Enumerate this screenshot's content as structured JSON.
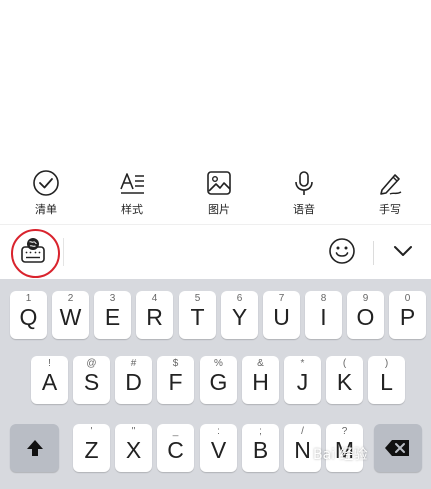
{
  "toolbar": {
    "items": [
      {
        "label": "清单",
        "icon": "checklist-icon"
      },
      {
        "label": "样式",
        "icon": "text-style-icon"
      },
      {
        "label": "图片",
        "icon": "image-icon"
      },
      {
        "label": "语音",
        "icon": "microphone-icon"
      },
      {
        "label": "手写",
        "icon": "handwriting-pen-icon"
      }
    ]
  },
  "keyboard_bar": {
    "left_icon": "keyboard-globe-icon",
    "emoji_icon": "emoji-smile-icon",
    "collapse_icon": "chevron-down-icon",
    "highlight_color": "#d9232d"
  },
  "keyboard": {
    "row1": [
      {
        "key": "Q",
        "sec": "1"
      },
      {
        "key": "W",
        "sec": "2"
      },
      {
        "key": "E",
        "sec": "3"
      },
      {
        "key": "R",
        "sec": "4"
      },
      {
        "key": "T",
        "sec": "5"
      },
      {
        "key": "Y",
        "sec": "6"
      },
      {
        "key": "U",
        "sec": "7"
      },
      {
        "key": "I",
        "sec": "8"
      },
      {
        "key": "O",
        "sec": "9"
      },
      {
        "key": "P",
        "sec": "0"
      }
    ],
    "row2": [
      {
        "key": "A",
        "sec": "!"
      },
      {
        "key": "S",
        "sec": "@"
      },
      {
        "key": "D",
        "sec": "#"
      },
      {
        "key": "F",
        "sec": "$"
      },
      {
        "key": "G",
        "sec": "%"
      },
      {
        "key": "H",
        "sec": "&"
      },
      {
        "key": "J",
        "sec": "*"
      },
      {
        "key": "K",
        "sec": "("
      },
      {
        "key": "L",
        "sec": ")"
      }
    ],
    "row3": [
      {
        "key": "Z",
        "sec": "'"
      },
      {
        "key": "X",
        "sec": "\""
      },
      {
        "key": "C",
        "sec": "_"
      },
      {
        "key": "V",
        "sec": ":"
      },
      {
        "key": "B",
        "sec": ";"
      },
      {
        "key": "N",
        "sec": "/"
      },
      {
        "key": "M",
        "sec": "?"
      }
    ],
    "shift_icon": "shift-arrow-icon",
    "backspace_icon": "backspace-icon"
  },
  "watermark": "Bai 经验"
}
